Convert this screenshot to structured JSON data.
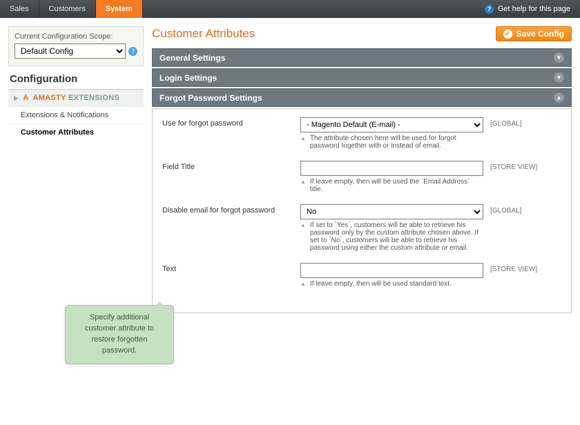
{
  "topnav": {
    "tabs": [
      {
        "label": "Sales"
      },
      {
        "label": "Customers"
      },
      {
        "label": "System"
      }
    ],
    "help_label": "Get help for this page"
  },
  "sidebar": {
    "scope": {
      "label": "Current Configuration Scope:",
      "selected": "Default Config"
    },
    "config_title": "Configuration",
    "section_header": {
      "amasty": "AMASTY",
      "ext": "EXTENSIONS"
    },
    "items": [
      {
        "label": "Extensions & Notifications"
      },
      {
        "label": "Customer Attributes"
      }
    ]
  },
  "content": {
    "title": "Customer Attributes",
    "save_label": "Save Config",
    "sections": [
      {
        "title": "General Settings"
      },
      {
        "title": "Login Settings"
      },
      {
        "title": "Forgot Password Settings"
      }
    ],
    "fields": {
      "use_forgot": {
        "label": "Use for forgot password",
        "selected": "- Magento Default (E-mail) -",
        "hint": "The attribute chosen here will be used for forgot password together with or instead of email.",
        "scope": "[GLOBAL]"
      },
      "field_title": {
        "label": "Field Title",
        "value": "",
        "hint": "If leave empty, then will be used the `Email Address` title.",
        "scope": "[STORE VIEW]"
      },
      "disable_email": {
        "label": "Disable email for forgot password",
        "selected": "No",
        "hint": "If set to `Yes`, customers will be able to retrieve his password only by the custom attribute chosen above. If set to `No`, customers will be able to retrieve his password using either the custom attribute or email.",
        "scope": "[GLOBAL]"
      },
      "text": {
        "label": "Text",
        "value": "",
        "hint": "If leave empty, then will be used standard text.",
        "scope": "[STORE VIEW]"
      }
    }
  },
  "bubble": {
    "text": "Specify additional customer attribute to restore forgotten password."
  }
}
